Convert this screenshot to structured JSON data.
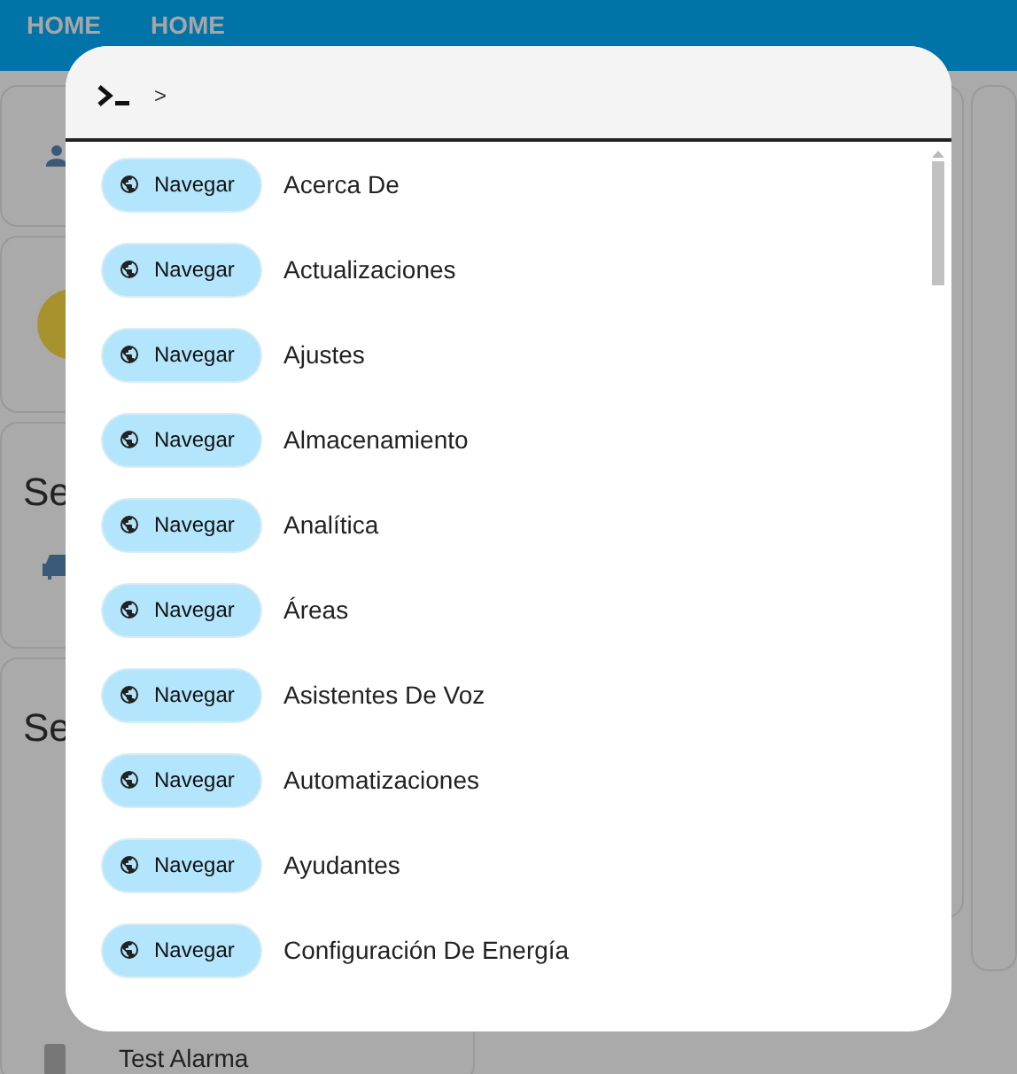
{
  "tabs": [
    {
      "label": "HOME"
    },
    {
      "label": "HOME"
    }
  ],
  "background": {
    "section_titles": [
      "Se",
      "Se"
    ],
    "entity": "Test Alarma"
  },
  "command_dialog": {
    "prompt": ">",
    "items": [
      {
        "chip": "Navegar",
        "label": "Acerca De"
      },
      {
        "chip": "Navegar",
        "label": "Actualizaciones"
      },
      {
        "chip": "Navegar",
        "label": "Ajustes"
      },
      {
        "chip": "Navegar",
        "label": "Almacenamiento"
      },
      {
        "chip": "Navegar",
        "label": "Analítica"
      },
      {
        "chip": "Navegar",
        "label": "Áreas"
      },
      {
        "chip": "Navegar",
        "label": "Asistentes De Voz"
      },
      {
        "chip": "Navegar",
        "label": "Automatizaciones"
      },
      {
        "chip": "Navegar",
        "label": "Ayudantes"
      },
      {
        "chip": "Navegar",
        "label": "Configuración De Energía"
      }
    ]
  }
}
